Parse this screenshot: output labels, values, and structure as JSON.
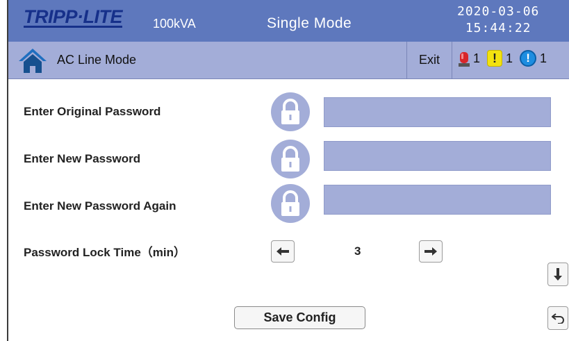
{
  "header": {
    "logo": "TRIPP·LITE",
    "capacity": "100kVA",
    "mode": "Single Mode",
    "date": "2020-03-06",
    "time": "15:44:22"
  },
  "subheader": {
    "status": "AC Line Mode",
    "exit_label": "Exit",
    "alarms": [
      {
        "icon": "red-alarm-icon",
        "count": "1"
      },
      {
        "icon": "yellow-warning-icon",
        "count": "1"
      },
      {
        "icon": "blue-info-icon",
        "count": "1"
      }
    ]
  },
  "form": {
    "original_password_label": "Enter Original Password",
    "new_password_label": "Enter New Password",
    "new_password_again_label": "Enter New Password Again",
    "lock_time_label": "Password Lock Time（min）",
    "lock_time_value": "3",
    "save_label": "Save Config"
  },
  "colors": {
    "header_bg": "#5e78bd",
    "subheader_bg": "#a3add8",
    "field_bg": "#a3add8",
    "lock_circle": "#a3add8",
    "logo": "#16308a"
  }
}
